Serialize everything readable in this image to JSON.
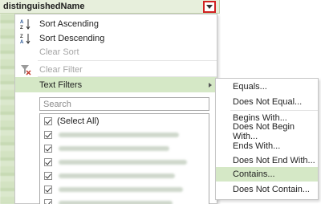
{
  "column": {
    "header_label": "distinguishedName"
  },
  "menu": {
    "sort_ascending": "Sort Ascending",
    "sort_descending": "Sort Descending",
    "clear_sort": "Clear Sort",
    "clear_filter": "Clear Filter",
    "text_filters": "Text Filters",
    "search_placeholder": "Search",
    "select_all": "(Select All)"
  },
  "submenu": {
    "items": [
      "Equals...",
      "Does Not Equal...",
      "Begins With...",
      "Does Not Begin With...",
      "Ends With...",
      "Does Not End With...",
      "Contains...",
      "Does Not Contain..."
    ],
    "highlighted": "Contains..."
  },
  "colors": {
    "header_bg": "#e7efdc",
    "highlight": "#d5e8c6",
    "filter_button_border": "#d12222"
  },
  "icons": [
    "sort-ascending-icon",
    "sort-descending-icon",
    "clear-filter-icon",
    "dropdown-arrow-icon",
    "submenu-arrow-icon",
    "checkbox-icon"
  ]
}
